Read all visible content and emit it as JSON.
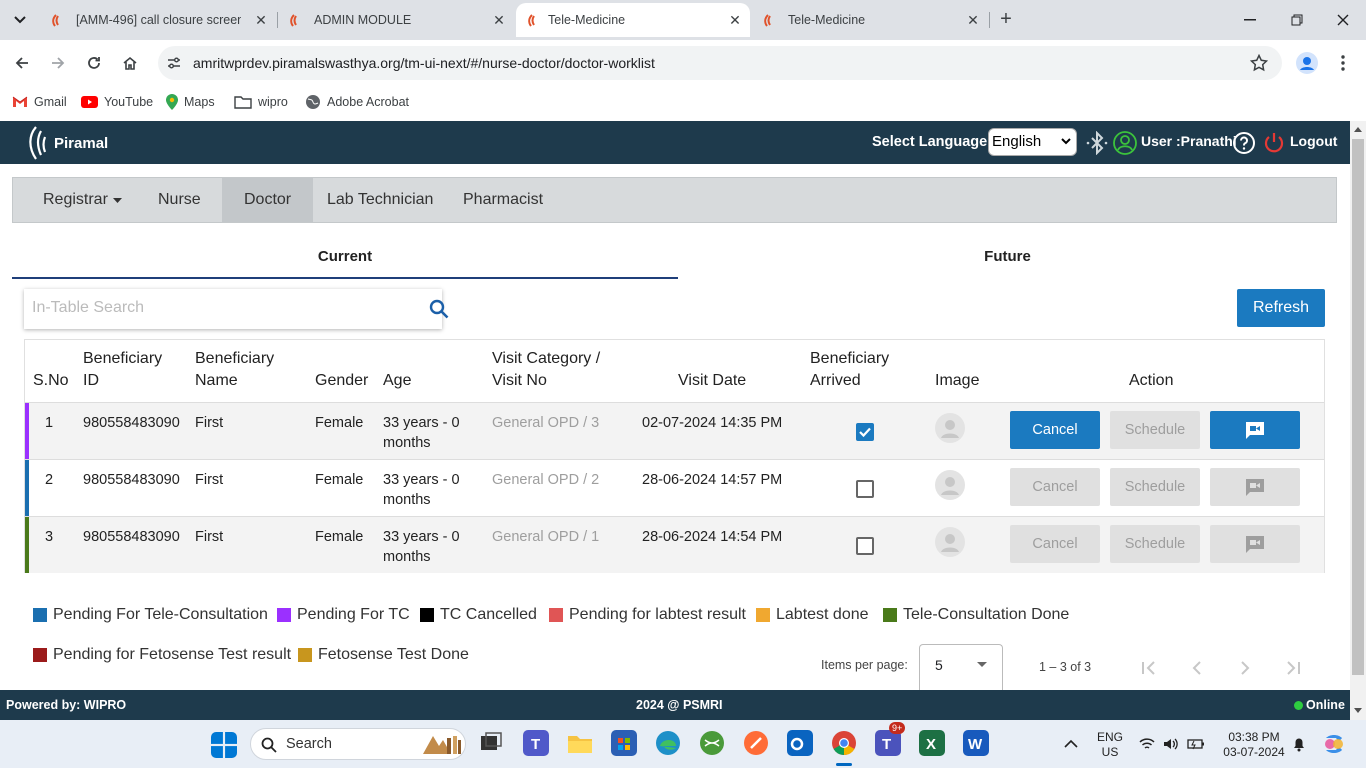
{
  "browser": {
    "tabs": [
      {
        "title": "[AMM-496] call closure screen i",
        "active": false
      },
      {
        "title": "ADMIN MODULE",
        "active": false
      },
      {
        "title": "Tele-Medicine",
        "active": true
      },
      {
        "title": "Tele-Medicine",
        "active": false
      }
    ],
    "url": "amritwprdev.piramalswasthya.org/tm-ui-next/#/nurse-doctor/doctor-worklist",
    "bookmarks": [
      "Gmail",
      "YouTube",
      "Maps",
      "wipro",
      "Adobe Acrobat"
    ]
  },
  "header": {
    "brand": "Piramal",
    "language_label": "Select Language:",
    "language_value": "English",
    "user_label": "User :Pranathi",
    "logout_label": "Logout"
  },
  "roles": [
    "Registrar",
    "Nurse",
    "Doctor",
    "Lab Technician",
    "Pharmacist"
  ],
  "active_role": "Doctor",
  "worklist_tabs": [
    "Current",
    "Future"
  ],
  "search": {
    "placeholder": "In-Table Search"
  },
  "refresh_label": "Refresh",
  "table": {
    "headers": {
      "sno": "S.No",
      "ben_id_1": "Beneficiary",
      "ben_id_2": "ID",
      "ben_name_1": "Beneficiary",
      "ben_name_2": "Name",
      "gender": "Gender",
      "age": "Age",
      "visit_cat_1": "Visit Category /",
      "visit_cat_2": "Visit No",
      "visit_date": "Visit Date",
      "arrived_1": "Beneficiary",
      "arrived_2": "Arrived",
      "image": "Image",
      "action": "Action"
    },
    "rows": [
      {
        "sno": "1",
        "id": "980558483090",
        "name": "First",
        "gender": "Female",
        "age_1": "33 years - 0",
        "age_2": "months",
        "category": "General OPD",
        "visit_no": "/ 3",
        "date": "02-07-2024 14:35 PM",
        "arrived": true,
        "status_color": "#9b30ff",
        "cancel": "Cancel",
        "schedule": "Schedule"
      },
      {
        "sno": "2",
        "id": "980558483090",
        "name": "First",
        "gender": "Female",
        "age_1": "33 years - 0",
        "age_2": "months",
        "category": "General OPD",
        "visit_no": "/ 2",
        "date": "28-06-2024 14:57 PM",
        "arrived": false,
        "status_color": "#1b6fb0",
        "cancel": "Cancel",
        "schedule": "Schedule"
      },
      {
        "sno": "3",
        "id": "980558483090",
        "name": "First",
        "gender": "Female",
        "age_1": "33 years - 0",
        "age_2": "months",
        "category": "General OPD",
        "visit_no": "/ 1",
        "date": "28-06-2024 14:54 PM",
        "arrived": false,
        "status_color": "#4a7a1a",
        "cancel": "Cancel",
        "schedule": "Schedule"
      }
    ]
  },
  "legend": [
    {
      "label": "Pending For Tele-Consultation",
      "color": "#1b6fb0"
    },
    {
      "label": "Pending For TC",
      "color": "#9b30ff"
    },
    {
      "label": "TC Cancelled",
      "color": "#000000"
    },
    {
      "label": "Pending for labtest result",
      "color": "#e05555"
    },
    {
      "label": "Labtest done",
      "color": "#f0a830"
    },
    {
      "label": "Tele-Consultation Done",
      "color": "#4a7a1a"
    },
    {
      "label": "Pending for Fetosense Test result",
      "color": "#9b1b1b"
    },
    {
      "label": "Fetosense Test Done",
      "color": "#c8961e"
    }
  ],
  "paginator": {
    "items_per_page_label": "Items per page:",
    "page_size": "5",
    "range": "1 – 3 of 3"
  },
  "footer": {
    "powered_by": "Powered by: WIPRO",
    "copyright": "2024 @ PSMRI",
    "status": "Online"
  },
  "taskbar": {
    "search_label": "Search",
    "lang_1": "ENG",
    "lang_2": "US",
    "time": "03:38 PM",
    "date": "03-07-2024",
    "teams_badge": "9+"
  },
  "colors": {
    "header_bg": "#1e3a4c",
    "accent": "#1b7ac0",
    "online": "#2ecc40"
  }
}
